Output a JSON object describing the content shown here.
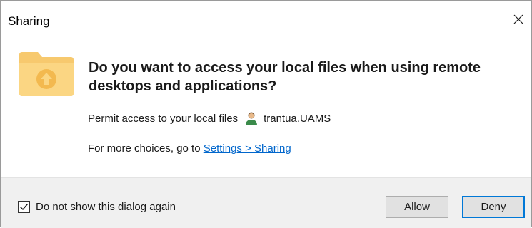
{
  "window": {
    "title": "Sharing",
    "close_label": "×"
  },
  "content": {
    "icon": "folder-upload-icon",
    "heading": "Do you want to access your local files when using remote desktops and applications?",
    "permit_text": "Permit access to your local files",
    "user_icon": "user-icon",
    "user_name": "trantua.UAMS",
    "more_prefix": "For more choices, go to ",
    "settings_link": "Settings > Sharing"
  },
  "footer": {
    "checkbox_label": "Do not show this dialog again",
    "checkbox_checked": true,
    "allow_label": "Allow",
    "deny_label": "Deny"
  },
  "colors": {
    "link": "#0066cc",
    "default_button_border": "#0078d7",
    "footer_background": "#f0f0f0",
    "folder": "#f5c56a"
  }
}
